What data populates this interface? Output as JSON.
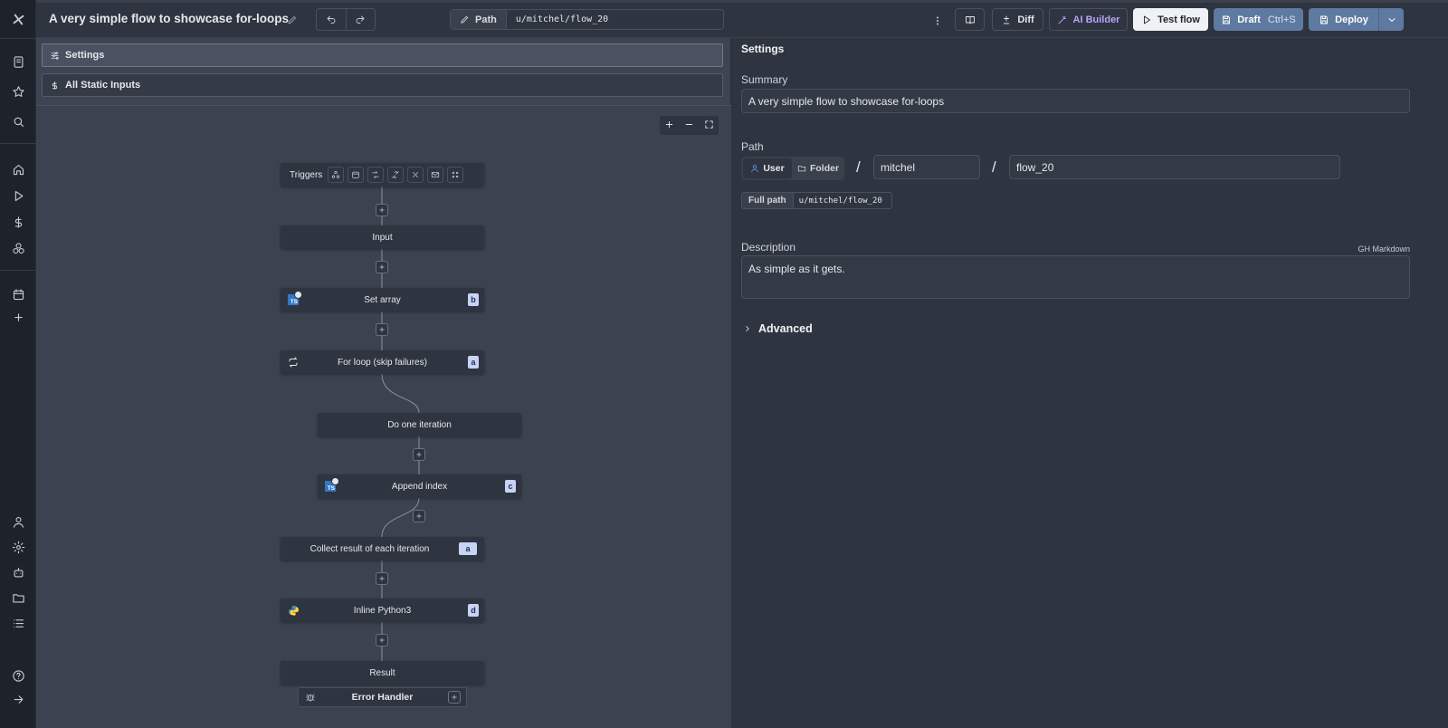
{
  "header": {
    "flow_title": "A very simple flow to showcase for-loops",
    "path_label": "Path",
    "path_value": "u/mitchel/flow_20",
    "diff_label": "Diff",
    "ai_builder_label": "AI Builder",
    "test_flow_label": "Test flow",
    "draft_label": "Draft",
    "draft_shortcut": "Ctrl+S",
    "deploy_label": "Deploy"
  },
  "canvas": {
    "settings_tab": "Settings",
    "static_inputs_tab": "All Static Inputs",
    "nodes": {
      "triggers": "Triggers",
      "input": "Input",
      "set_array": {
        "label": "Set array",
        "badge": "b"
      },
      "for_loop": {
        "label": "For loop (skip failures)",
        "badge": "a"
      },
      "do_one_iteration": "Do one iteration",
      "append_index": {
        "label": "Append index",
        "badge": "c"
      },
      "collect_result": {
        "label": "Collect result of each iteration",
        "badge": "a"
      },
      "inline_python": {
        "label": "Inline Python3",
        "badge": "d"
      },
      "result": "Result",
      "error_handler": "Error Handler"
    },
    "ts_badge": "TS"
  },
  "settings": {
    "title": "Settings",
    "summary_label": "Summary",
    "summary_value": "A very simple flow to showcase for-loops",
    "path_label": "Path",
    "owner_user": "User",
    "owner_folder": "Folder",
    "separator": "/",
    "owner_name": "mitchel",
    "flow_name": "flow_20",
    "full_path_label": "Full path",
    "full_path_value": "u/mitchel/flow_20",
    "description_label": "Description",
    "markdown_hint": "GH Markdown",
    "description_value": "As simple as it gets.",
    "advanced_label": "Advanced"
  },
  "colors": {
    "accent": "#5e7aa0",
    "badge": "#c7d3f5",
    "ai": "#b9a3f5"
  }
}
